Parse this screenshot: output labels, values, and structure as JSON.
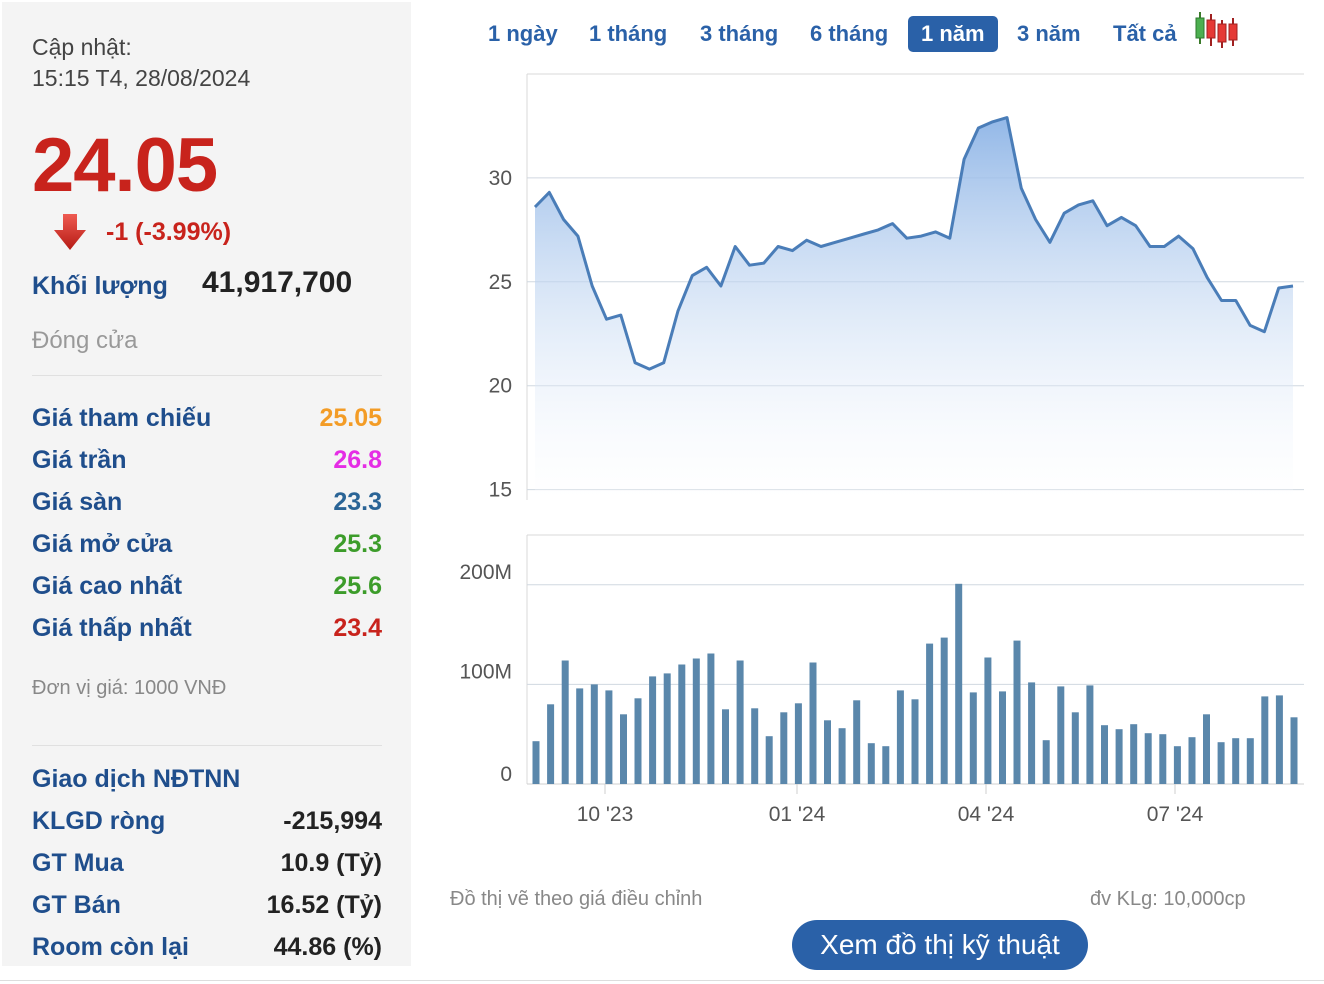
{
  "stock": {
    "update_label": "Cập nhật:",
    "update_time": "15:15 T4, 28/08/2024",
    "price": "24.05",
    "change": "-1 (-3.99%)",
    "volume_label": "Khối lượng",
    "volume_value": "41,917,700",
    "status": "Đóng cửa",
    "prices": [
      {
        "label": "Giá tham chiếu",
        "value": "25.05",
        "color": "#f39c26"
      },
      {
        "label": "Giá trần",
        "value": "26.8",
        "color": "#e52de5"
      },
      {
        "label": "Giá sàn",
        "value": "23.3",
        "color": "#2a6496"
      },
      {
        "label": "Giá mở cửa",
        "value": "25.3",
        "color": "#3c9c2a"
      },
      {
        "label": "Giá cao nhất",
        "value": "25.6",
        "color": "#3c9c2a"
      },
      {
        "label": "Giá thấp nhất",
        "value": "23.4",
        "color": "#c8231c"
      }
    ],
    "unit_note": "Đơn vị giá: 1000 VNĐ",
    "foreign": {
      "title": "Giao dịch NĐTNN",
      "rows": [
        {
          "label": "KLGD ròng",
          "value": "-215,994"
        },
        {
          "label": "GT Mua",
          "value": "10.9 (Tỷ)"
        },
        {
          "label": "GT Bán",
          "value": "16.52 (Tỷ)"
        },
        {
          "label": "Room còn lại",
          "value": "44.86 (%)"
        }
      ]
    }
  },
  "range_tabs": [
    {
      "label": "1 ngày",
      "active": false
    },
    {
      "label": "1 tháng",
      "active": false
    },
    {
      "label": "3 tháng",
      "active": false
    },
    {
      "label": "6 tháng",
      "active": false
    },
    {
      "label": "1 năm",
      "active": true
    },
    {
      "label": "3 năm",
      "active": false
    },
    {
      "label": "Tất cả",
      "active": false
    }
  ],
  "icons": {
    "candlestick": "candlestick-chart-icon",
    "down_arrow": "down-arrow-icon"
  },
  "colors": {
    "accent": "#2a61a8",
    "down": "#c8231c",
    "line": "#4a7db8",
    "bar": "#5a87ab"
  },
  "chart_data": [
    {
      "type": "area",
      "x_ticks": [
        "10 '23",
        "01 '24",
        "04 '24",
        "07 '24"
      ],
      "y_ticks": [
        "15",
        "20",
        "25",
        "30"
      ],
      "ylim": [
        14.5,
        35
      ],
      "grid": true,
      "values": [
        28.6,
        29.3,
        28.0,
        27.2,
        24.8,
        23.2,
        23.4,
        21.1,
        20.8,
        21.1,
        23.6,
        25.3,
        25.7,
        24.8,
        26.7,
        25.8,
        25.9,
        26.7,
        26.5,
        27.0,
        26.7,
        26.9,
        27.1,
        27.3,
        27.5,
        27.8,
        27.1,
        27.2,
        27.4,
        27.1,
        30.9,
        32.4,
        32.7,
        32.9,
        29.5,
        28.0,
        26.9,
        28.3,
        28.7,
        28.9,
        27.7,
        28.1,
        27.7,
        26.7,
        26.7,
        27.2,
        26.6,
        25.2,
        24.1,
        24.1,
        22.9,
        22.6,
        24.7,
        24.8
      ]
    },
    {
      "type": "bar",
      "y_ticks": [
        "0",
        "100M",
        "200M"
      ],
      "ylim": [
        0,
        250
      ],
      "unit_note": "đv KLg: 10,000cp",
      "values": [
        43,
        80,
        124,
        96,
        100,
        94,
        70,
        86,
        108,
        111,
        120,
        126,
        131,
        75,
        124,
        76,
        48,
        72,
        81,
        122,
        64,
        56,
        84,
        41,
        38,
        94,
        85,
        141,
        147,
        201,
        92,
        127,
        93,
        144,
        102,
        44,
        98,
        72,
        99,
        59,
        55,
        60,
        51,
        50,
        38,
        47,
        70,
        42,
        46,
        46,
        88,
        89,
        67
      ]
    }
  ],
  "footer": {
    "note": "Đồ thị vẽ theo giá điều chỉnh",
    "button": "Xem đồ thị kỹ thuật"
  }
}
